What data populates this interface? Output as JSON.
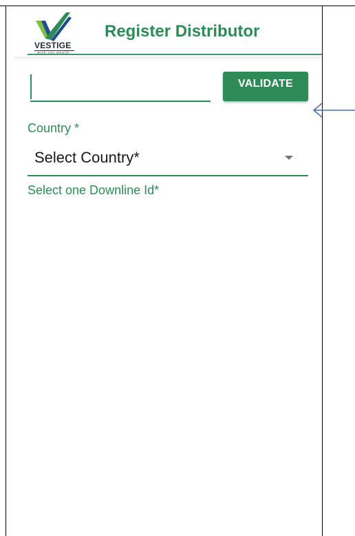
{
  "header": {
    "logo_text": "VESTIGE",
    "logo_tagline": "wish you wealth",
    "title": "Register Distributor"
  },
  "form": {
    "id_input_value": "",
    "validate_label": "VALIDATE",
    "country_label": "Country *",
    "country_selected": "Select Country*",
    "downline_label": "Select one Downline Id*"
  },
  "colors": {
    "accent": "#2e8b57",
    "arrow": "#4a6fb5"
  },
  "icons": {
    "logo": "vestige-checkmark-logo",
    "dropdown": "caret-down-icon",
    "annotation": "left-arrow-icon"
  }
}
